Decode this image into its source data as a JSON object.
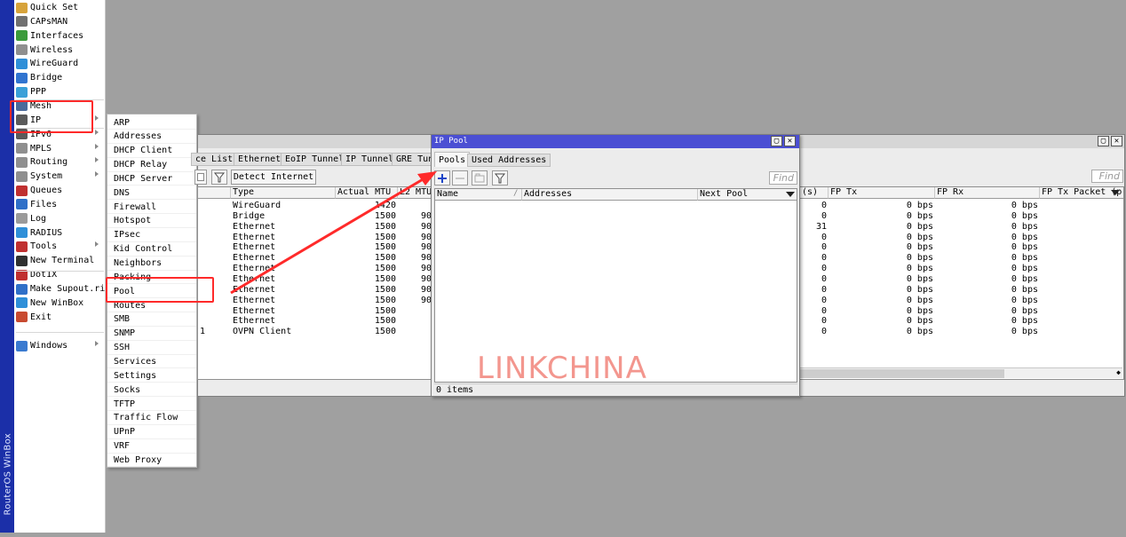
{
  "app": {
    "brand": "RouterOS WinBox"
  },
  "sidebar": {
    "items": [
      {
        "label": "Quick Set",
        "icon": "quick-set-icon",
        "color": "#d7a33b",
        "submenu": false
      },
      {
        "label": "CAPsMAN",
        "icon": "capsman-icon",
        "color": "#707070",
        "submenu": false
      },
      {
        "label": "Interfaces",
        "icon": "interfaces-icon",
        "color": "#3b9b3b",
        "submenu": false
      },
      {
        "label": "Wireless",
        "icon": "wireless-icon",
        "color": "#8f8f8f",
        "submenu": false
      },
      {
        "label": "WireGuard",
        "icon": "wireguard-icon",
        "color": "#2f8fd8",
        "submenu": false
      },
      {
        "label": "Bridge",
        "icon": "bridge-icon",
        "color": "#3174d0",
        "submenu": false
      },
      {
        "label": "PPP",
        "icon": "ppp-icon",
        "color": "#3aa0d8",
        "submenu": false
      },
      {
        "label": "Mesh",
        "icon": "mesh-icon",
        "color": "#4b6b9b",
        "submenu": false
      },
      {
        "label": "IP",
        "icon": "ip-icon",
        "color": "#5a5a5a",
        "submenu": true
      },
      {
        "label": "IPv6",
        "icon": "ipv6-icon",
        "color": "#5a5a5a",
        "submenu": true
      },
      {
        "label": "MPLS",
        "icon": "mpls-icon",
        "color": "#8f8f8f",
        "submenu": true
      },
      {
        "label": "Routing",
        "icon": "routing-icon",
        "color": "#8f8f8f",
        "submenu": true
      },
      {
        "label": "System",
        "icon": "system-icon",
        "color": "#8f8f8f",
        "submenu": true
      },
      {
        "label": "Queues",
        "icon": "queues-icon",
        "color": "#c03030",
        "submenu": false
      },
      {
        "label": "Files",
        "icon": "files-icon",
        "color": "#2f6fc8",
        "submenu": false
      },
      {
        "label": "Log",
        "icon": "log-icon",
        "color": "#9a9a9a",
        "submenu": false
      },
      {
        "label": "RADIUS",
        "icon": "radius-icon",
        "color": "#2f8fd8",
        "submenu": false
      },
      {
        "label": "Tools",
        "icon": "tools-icon",
        "color": "#c03030",
        "submenu": true
      },
      {
        "label": "New Terminal",
        "icon": "terminal-icon",
        "color": "#303030",
        "submenu": false
      },
      {
        "label": "Dot1X",
        "icon": "dot1x-icon",
        "color": "#c03030",
        "submenu": false
      },
      {
        "label": "Make Supout.rif",
        "icon": "supout-icon",
        "color": "#3070c8",
        "submenu": false
      },
      {
        "label": "New WinBox",
        "icon": "winbox-icon",
        "color": "#2f8fd8",
        "submenu": false
      },
      {
        "label": "Exit",
        "icon": "exit-icon",
        "color": "#c84a30",
        "submenu": false
      },
      {
        "label": "Windows",
        "icon": "windows-icon",
        "color": "#3a7ad0",
        "submenu": true
      }
    ]
  },
  "ip_menu": {
    "items": [
      "ARP",
      "Addresses",
      "DHCP Client",
      "DHCP Relay",
      "DHCP Server",
      "DNS",
      "Firewall",
      "Hotspot",
      "IPsec",
      "Kid Control",
      "Neighbors",
      "Packing",
      "Pool",
      "Routes",
      "SMB",
      "SNMP",
      "SSH",
      "Services",
      "Settings",
      "Socks",
      "TFTP",
      "Traffic Flow",
      "UPnP",
      "VRF",
      "Web Proxy"
    ]
  },
  "interface_window": {
    "tabs": [
      "ce List",
      "Ethernet",
      "EoIP Tunnel",
      "IP Tunnel",
      "GRE Tunn"
    ],
    "detect_button": "Detect Internet",
    "find_placeholder": "Find",
    "left_columns": [
      "",
      "Type",
      "Actual MTU",
      "L2 MTU"
    ],
    "right_columns": [
      "(s)",
      "FP Tx",
      "FP Rx",
      "FP Tx Packet (p"
    ],
    "rows": [
      {
        "name": "",
        "type": "WireGuard",
        "mtu": "1420",
        "l2": "",
        "p": "0",
        "tx": "0 bps",
        "rx": "0 bps"
      },
      {
        "name": "",
        "type": "Bridge",
        "mtu": "1500",
        "l2": "90",
        "p": "0",
        "tx": "0 bps",
        "rx": "0 bps"
      },
      {
        "name": "",
        "type": "Ethernet",
        "mtu": "1500",
        "l2": "90",
        "p": "31",
        "tx": "0 bps",
        "rx": "0 bps"
      },
      {
        "name": "",
        "type": "Ethernet",
        "mtu": "1500",
        "l2": "90",
        "p": "0",
        "tx": "0 bps",
        "rx": "0 bps"
      },
      {
        "name": "",
        "type": "Ethernet",
        "mtu": "1500",
        "l2": "90",
        "p": "0",
        "tx": "0 bps",
        "rx": "0 bps"
      },
      {
        "name": "",
        "type": "Ethernet",
        "mtu": "1500",
        "l2": "90",
        "p": "0",
        "tx": "0 bps",
        "rx": "0 bps"
      },
      {
        "name": "",
        "type": "Ethernet",
        "mtu": "1500",
        "l2": "90",
        "p": "0",
        "tx": "0 bps",
        "rx": "0 bps"
      },
      {
        "name": "",
        "type": "Ethernet",
        "mtu": "1500",
        "l2": "90",
        "p": "0",
        "tx": "0 bps",
        "rx": "0 bps"
      },
      {
        "name": "",
        "type": "Ethernet",
        "mtu": "1500",
        "l2": "90",
        "p": "0",
        "tx": "0 bps",
        "rx": "0 bps"
      },
      {
        "name": "",
        "type": "Ethernet",
        "mtu": "1500",
        "l2": "90",
        "p": "0",
        "tx": "0 bps",
        "rx": "0 bps"
      },
      {
        "name": "",
        "type": "Ethernet",
        "mtu": "1500",
        "l2": "",
        "p": "0",
        "tx": "0 bps",
        "rx": "0 bps"
      },
      {
        "name": "",
        "type": "Ethernet",
        "mtu": "1500",
        "l2": "",
        "p": "0",
        "tx": "0 bps",
        "rx": "0 bps"
      },
      {
        "name": "1",
        "type": "OVPN Client",
        "mtu": "1500",
        "l2": "",
        "p": "0",
        "tx": "0 bps",
        "rx": "0 bps"
      }
    ]
  },
  "pool_window": {
    "title": "IP Pool",
    "tabs": [
      "Pools",
      "Used Addresses"
    ],
    "find_placeholder": "Find",
    "columns": [
      "Name",
      "Addresses",
      "Next Pool"
    ],
    "status": "0 items"
  },
  "watermark": "LINKCHINA",
  "colors": {
    "annotation": "#ff2a2a",
    "title_active": "#4b4fd3",
    "brand_strip": "#1b2fa8"
  }
}
